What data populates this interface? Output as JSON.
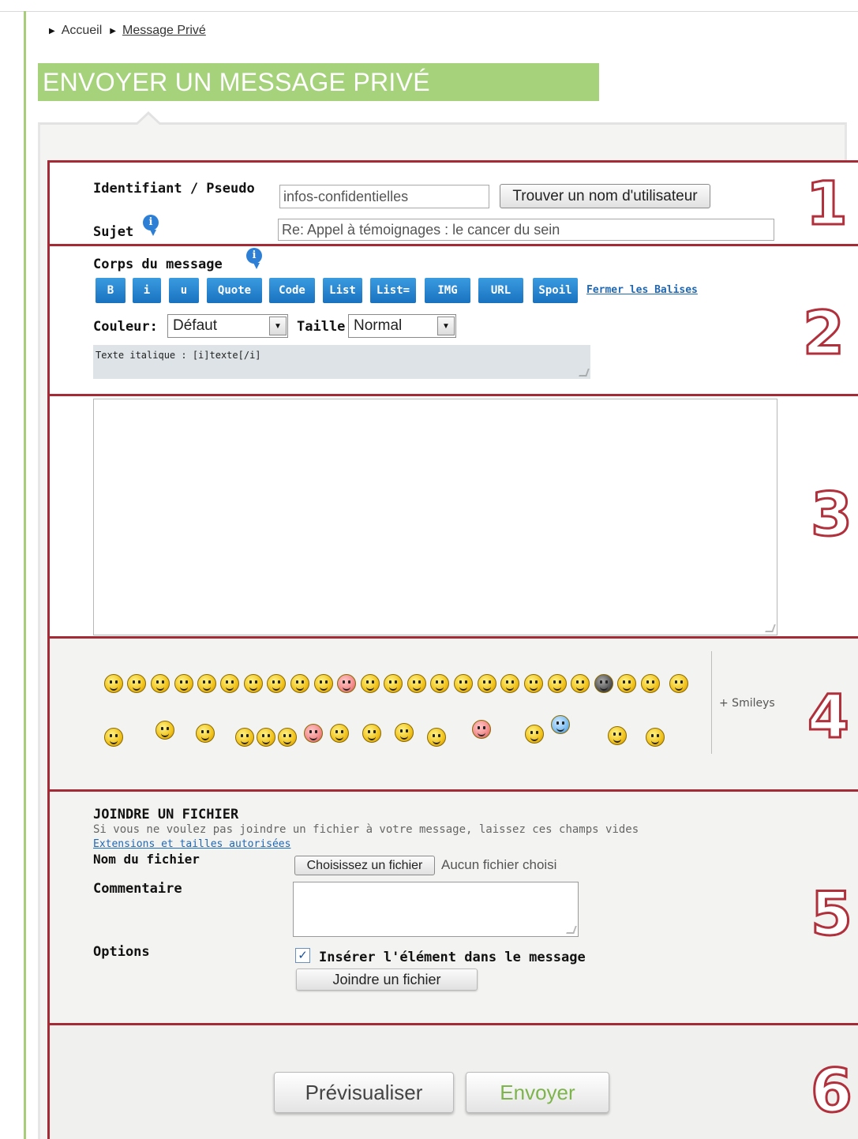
{
  "breadcrumb": {
    "home": "Accueil",
    "current": "Message Privé"
  },
  "page": {
    "title": "ENVOYER UN MESSAGE PRIVÉ"
  },
  "section_numbers": [
    "1",
    "2",
    "3",
    "4",
    "5",
    "6"
  ],
  "recipient": {
    "label": "Identifiant / Pseudo",
    "value": "infos-confidentielles",
    "find_button": "Trouver un nom d'utilisateur"
  },
  "subject": {
    "label": "Sujet",
    "value": "Re: Appel à témoignages : le cancer du sein"
  },
  "editor": {
    "label": "Corps du message",
    "tag_buttons": [
      "B",
      "i",
      "u",
      "Quote",
      "Code",
      "List",
      "List=",
      "IMG",
      "URL",
      "Spoil"
    ],
    "close_tags": "Fermer les Balises",
    "color_label": "Couleur:",
    "color_value": "Défaut",
    "size_label": "Taille:",
    "size_value": "Normal",
    "help_text": "Texte italique : [i]texte[/i]",
    "body_value": ""
  },
  "smileys": {
    "more_link": "+ Smileys"
  },
  "attachment": {
    "title": "JOINDRE UN FICHIER",
    "description": "Si vous ne voulez pas joindre un fichier à votre message, laissez ces champs vides",
    "extensions_link": "Extensions et tailles autorisées",
    "filename_label": "Nom du fichier",
    "choose_button": "Choisissez un fichier",
    "no_file": "Aucun fichier choisi",
    "comment_label": "Commentaire",
    "comment_value": "",
    "options_label": "Options",
    "insert_checked": true,
    "insert_label": "Insérer l'élément dans le message",
    "attach_button": "Joindre un fichier"
  },
  "actions": {
    "preview": "Prévisualiser",
    "send": "Envoyer"
  },
  "colors": {
    "banner": "#a6d27c",
    "section_border": "#a42b36",
    "tag_button": "#1f7cc9",
    "send_text": "#7db44c",
    "link": "#2068b5"
  }
}
